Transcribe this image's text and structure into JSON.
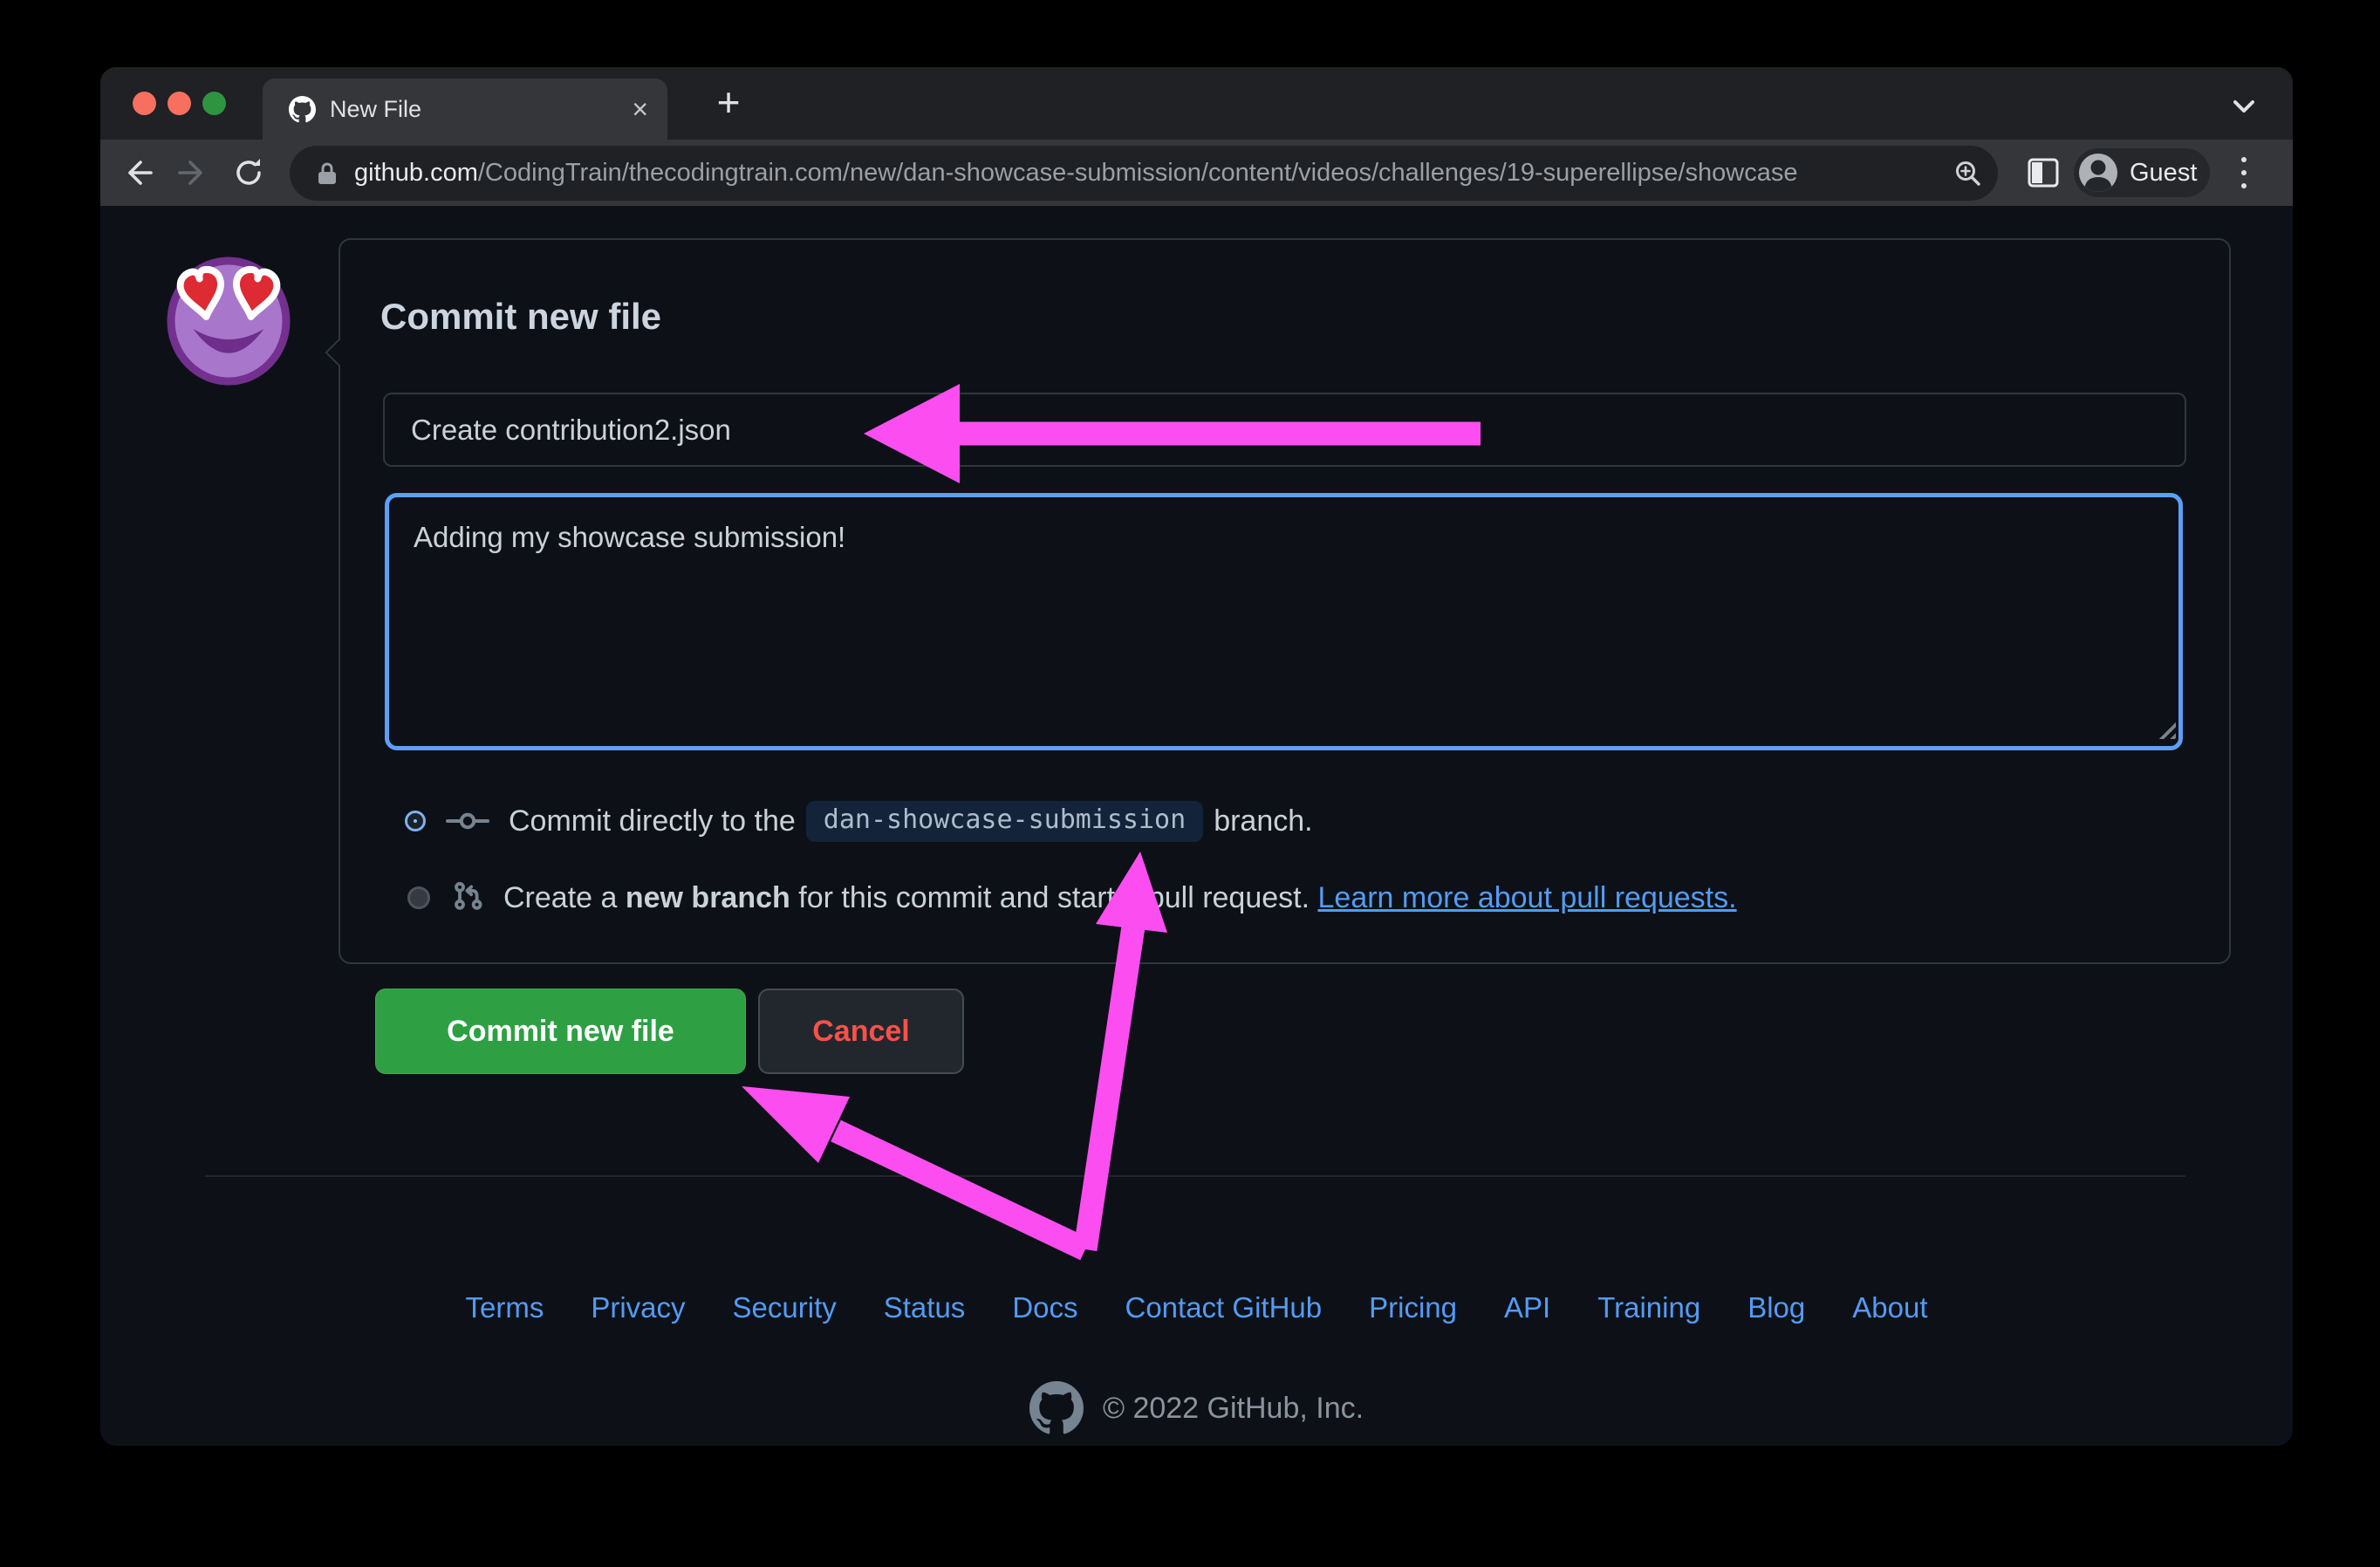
{
  "browser": {
    "tab": {
      "title": "New File",
      "close_glyph": "×",
      "new_tab_glyph": "+"
    },
    "url": {
      "domain": "github.com",
      "path": "/CodingTrain/thecodingtrain.com/new/dan-showcase-submission/content/videos/challenges/19-superellipse/showcase"
    },
    "profile_label": "Guest"
  },
  "page": {
    "heading": "Commit new file",
    "commit_message_value": "Create contribution2.json",
    "description_value": "Adding my showcase submission!",
    "radio_direct": {
      "pre": "Commit directly to the",
      "branch": "dan-showcase-submission",
      "post": "branch."
    },
    "radio_new_branch": {
      "pre": "Create a ",
      "bold": "new branch",
      "post": " for this commit and start a pull request. ",
      "link": "Learn more about pull requests."
    },
    "commit_button": "Commit new file",
    "cancel_button": "Cancel"
  },
  "footer": {
    "links": [
      "Terms",
      "Privacy",
      "Security",
      "Status",
      "Docs",
      "Contact GitHub",
      "Pricing",
      "API",
      "Training",
      "Blog",
      "About"
    ],
    "copyright": "© 2022 GitHub, Inc."
  },
  "colors": {
    "annotation_pink": "#fc4ef0",
    "focus_blue": "#5d9ef6",
    "link_blue": "#539bf5",
    "commit_green": "#2ea043",
    "cancel_red": "#f85149",
    "page_bg": "#0d1117"
  }
}
